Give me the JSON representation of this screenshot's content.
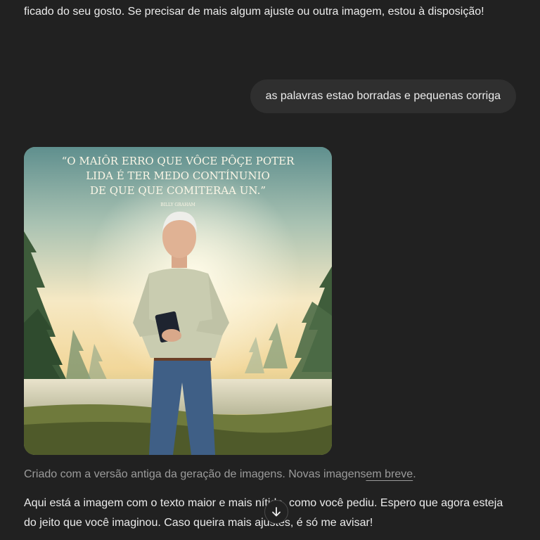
{
  "conversation": {
    "previous_assistant_text": "ficado do seu gosto. Se precisar de mais algum ajuste ou outra imagem, estou à disposição!",
    "user_message": "as palavras estao borradas e pequenas corriga",
    "image": {
      "quote_lines": [
        "“O MAIÔR ERRO QUE VÔCE PÔÇE POTER",
        "LIDA  É TER MEDO CONTÍNUNIO",
        "DE QUE QUE COMITERAA UN.”"
      ],
      "attribution": "BILLY GRAHAM",
      "icon": "generated-image-portrait"
    },
    "caption": {
      "text": "Criado com a versão antiga da geração de imagens. Novas imagens",
      "link": "em breve",
      "suffix": "."
    },
    "reply_text": "Aqui está a imagem com o texto maior e mais nítido, como você pediu. Espero que agora esteja do jeito que você imaginou. Caso queira mais ajustes, é só me avisar!"
  },
  "controls": {
    "scroll_down_icon": "arrow-down-icon"
  },
  "colors": {
    "background": "#212121",
    "user_bubble": "#2f2f2f",
    "text": "#ececec",
    "muted_text": "#9b9b9b"
  }
}
